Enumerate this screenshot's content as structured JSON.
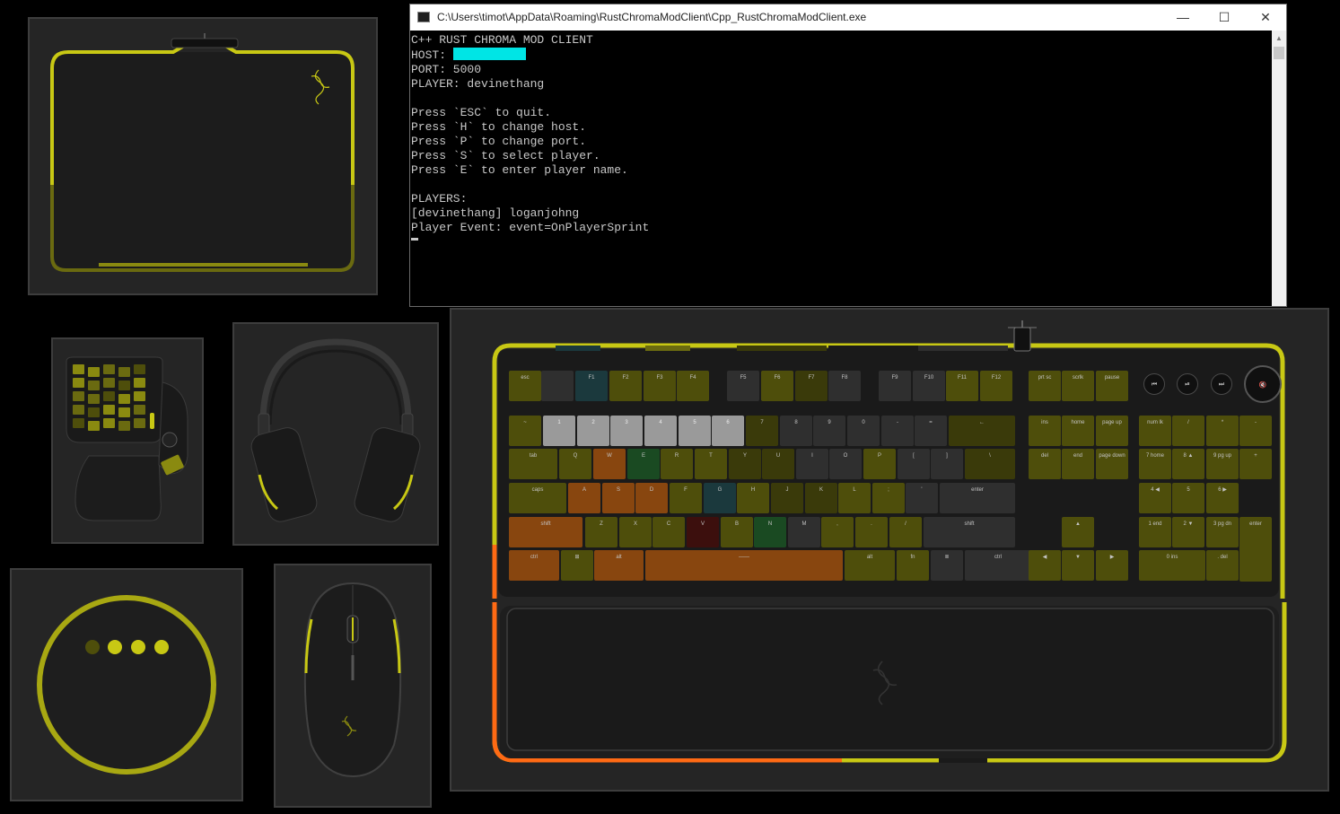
{
  "console": {
    "title": "C:\\Users\\timot\\AppData\\Roaming\\RustChromaModClient\\Cpp_RustChromaModClient.exe",
    "minimize": "—",
    "maximize": "☐",
    "close": "✕",
    "header": "C++ RUST CHROMA MOD CLIENT",
    "host_label": "HOST: ",
    "port_line": "PORT: 5000",
    "player_line": "PLAYER: devinethang",
    "help": [
      "Press `ESC` to quit.",
      "Press `H` to change host.",
      "Press `P` to change port.",
      "Press `S` to select player.",
      "Press `E` to enter player name."
    ],
    "players_header": "PLAYERS:",
    "players_line": "[devinethang] loganjohng",
    "event_line": "Player Event: event=OnPlayerSprint"
  },
  "colors": {
    "yellow": "#c8c814",
    "dim_yellow": "#6a6a10",
    "orange": "#ff6a14",
    "host_mask": "#00e5e5",
    "panel_bg": "#252525"
  },
  "keyboard": {
    "media": [
      "⏮",
      "⏯",
      "⏭",
      "🔇"
    ],
    "rows": [
      [
        [
          "esc",
          "k1"
        ],
        [
          "",
          "k0"
        ],
        [
          "F1",
          "k5"
        ],
        [
          "F2",
          "k1"
        ],
        [
          "F3",
          "k1"
        ],
        [
          "F4",
          "k1"
        ],
        [
          "F5",
          "k0"
        ],
        [
          "F6",
          "k1"
        ],
        [
          "F7",
          "k8"
        ],
        [
          "F8",
          "k0"
        ],
        [
          "F9",
          "k0"
        ],
        [
          "F10",
          "k0"
        ],
        [
          "F11",
          "k1"
        ],
        [
          "F12",
          "k1"
        ],
        [
          "prt sc",
          "k1"
        ],
        [
          "scrlk",
          "k1"
        ],
        [
          "pause",
          "k1"
        ]
      ],
      [
        [
          "~",
          "k1"
        ],
        [
          "1",
          "k4"
        ],
        [
          "2",
          "k4"
        ],
        [
          "3",
          "k4"
        ],
        [
          "4",
          "k4"
        ],
        [
          "5",
          "k4"
        ],
        [
          "6",
          "k4"
        ],
        [
          "7",
          "k8"
        ],
        [
          "8",
          "k0"
        ],
        [
          "9",
          "k0"
        ],
        [
          "0",
          "k0"
        ],
        [
          "-",
          "k0"
        ],
        [
          "=",
          "k0"
        ],
        [
          "←",
          "k8"
        ],
        [
          "ins",
          "k1"
        ],
        [
          "home",
          "k1"
        ],
        [
          "page up",
          "k1"
        ],
        [
          "num lk",
          "k1"
        ],
        [
          "/",
          "k1"
        ],
        [
          "*",
          "k1"
        ],
        [
          "-",
          "k1"
        ]
      ],
      [
        [
          "tab",
          "k1"
        ],
        [
          "Q",
          "k1"
        ],
        [
          "W",
          "k3"
        ],
        [
          "E",
          "k6"
        ],
        [
          "R",
          "k1"
        ],
        [
          "T",
          "k1"
        ],
        [
          "Y",
          "k8"
        ],
        [
          "U",
          "k8"
        ],
        [
          "I",
          "k0"
        ],
        [
          "O",
          "k0"
        ],
        [
          "P",
          "k1"
        ],
        [
          "[",
          "k0"
        ],
        [
          "]",
          "k0"
        ],
        [
          "\\",
          "k8"
        ],
        [
          "del",
          "k1"
        ],
        [
          "end",
          "k1"
        ],
        [
          "page down",
          "k1"
        ],
        [
          "7 home",
          "k1"
        ],
        [
          "8 ▲",
          "k1"
        ],
        [
          "9 pg up",
          "k1"
        ],
        [
          "+",
          "k1"
        ]
      ],
      [
        [
          "caps",
          "k1"
        ],
        [
          "A",
          "k3"
        ],
        [
          "S",
          "k3"
        ],
        [
          "D",
          "k3"
        ],
        [
          "F",
          "k1"
        ],
        [
          "G",
          "k5"
        ],
        [
          "H",
          "k1"
        ],
        [
          "J",
          "k8"
        ],
        [
          "K",
          "k8"
        ],
        [
          "L",
          "k1"
        ],
        [
          ";",
          "k1"
        ],
        [
          "'",
          "k0"
        ],
        [
          "enter",
          "k0"
        ],
        [
          "4 ◀",
          "k1"
        ],
        [
          "5",
          "k1"
        ],
        [
          "6 ▶",
          "k1"
        ]
      ],
      [
        [
          "shift",
          "k3"
        ],
        [
          "Z",
          "k1"
        ],
        [
          "X",
          "k1"
        ],
        [
          "C",
          "k1"
        ],
        [
          "V",
          "k7"
        ],
        [
          "B",
          "k1"
        ],
        [
          "N",
          "k6"
        ],
        [
          "M",
          "k0"
        ],
        [
          ",",
          "k1"
        ],
        [
          ".",
          "k1"
        ],
        [
          "/",
          "k1"
        ],
        [
          "shift",
          "k0"
        ],
        [
          "▲",
          "k1"
        ],
        [
          "1 end",
          "k1"
        ],
        [
          "2 ▼",
          "k1"
        ],
        [
          "3 pg dn",
          "k1"
        ],
        [
          "enter",
          "k1"
        ]
      ],
      [
        [
          "ctrl",
          "k3"
        ],
        [
          "⊞",
          "k1"
        ],
        [
          "alt",
          "k3"
        ],
        [
          "——",
          "k3"
        ],
        [
          "alt",
          "k1"
        ],
        [
          "fn",
          "k1"
        ],
        [
          "≣",
          "k0"
        ],
        [
          "ctrl",
          "k0"
        ],
        [
          "◀",
          "k1"
        ],
        [
          "▼",
          "k1"
        ],
        [
          "▶",
          "k1"
        ],
        [
          "0 ins",
          "k1"
        ],
        [
          ". del",
          "k1"
        ]
      ]
    ]
  }
}
